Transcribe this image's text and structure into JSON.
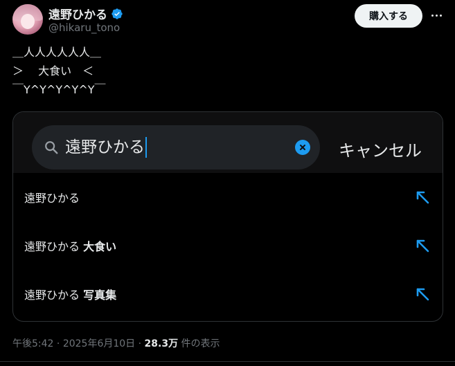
{
  "author": {
    "display_name": "遠野ひかる",
    "handle": "@hikaru_tono"
  },
  "header": {
    "buy_label": "購入する"
  },
  "tweet": {
    "ascii_art": "＿人人人人人人＿\n＞　 大食い　＜\n￣Y^Y^Y^Y^Y￣"
  },
  "search": {
    "query": "遠野ひかる",
    "cancel_label": "キャンセル"
  },
  "suggestions": [
    {
      "base": "遠野ひかる",
      "extra": ""
    },
    {
      "base": "遠野ひかる",
      "extra": "大食い"
    },
    {
      "base": "遠野ひかる",
      "extra": "写真集"
    }
  ],
  "meta": {
    "time": "午後5:42",
    "separator": "·",
    "date": "2025年6月10日",
    "views": "28.3万",
    "views_suffix": "件の表示"
  },
  "colors": {
    "accent": "#1d9bf0",
    "background": "#000000",
    "secondary_text": "#71767b"
  }
}
